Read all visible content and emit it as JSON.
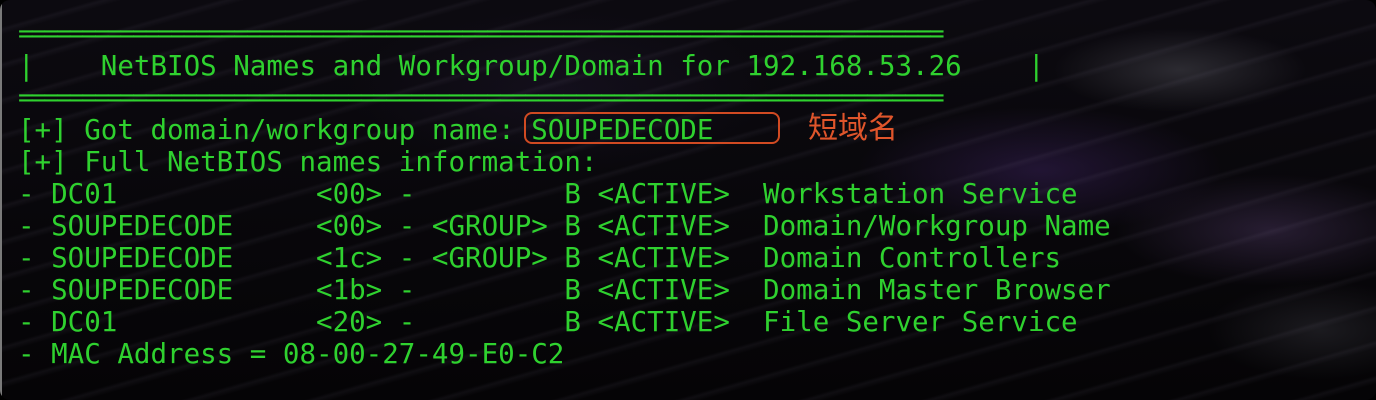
{
  "terminal": {
    "rule_top": "=========================================================================",
    "header": "|    NetBIOS Names and Workgroup/Domain for 192.168.53.26    |",
    "rule_bottom": "=========================================================================",
    "got_domain_prefix": "[+] Got domain/workgroup name: ",
    "domain_name": "SOUPEDECODE",
    "full_info": "[+] Full NetBIOS names information:",
    "rows": [
      "- DC01            <00> -         B <ACTIVE>  Workstation Service",
      "- SOUPEDECODE     <00> - <GROUP> B <ACTIVE>  Domain/Workgroup Name",
      "- SOUPEDECODE     <1c> - <GROUP> B <ACTIVE>  Domain Controllers",
      "- SOUPEDECODE     <1b> -         B <ACTIVE>  Domain Master Browser",
      "- DC01            <20> -         B <ACTIVE>  File Server Service"
    ],
    "mac": "- MAC Address = 08-00-27-49-E0-C2"
  },
  "annotation": {
    "text": "短域名",
    "color": "#e0552b"
  },
  "colors": {
    "terminal_text": "#2fd12f",
    "highlight_box": "#d14a22"
  }
}
